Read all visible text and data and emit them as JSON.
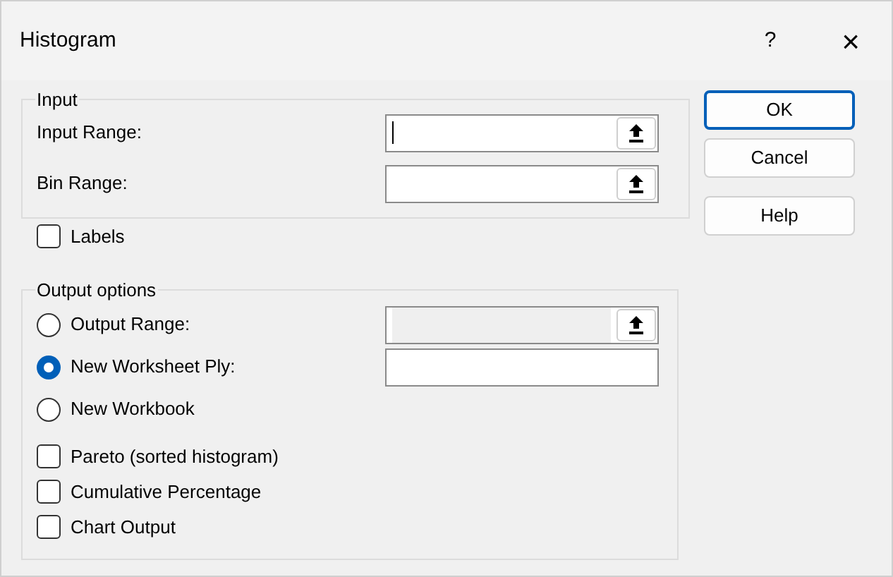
{
  "window": {
    "title": "Histogram",
    "help": "?",
    "close": "×"
  },
  "input_group": {
    "title": "Input",
    "fields": [
      {
        "label": "Input Range:",
        "focused": true
      },
      {
        "label": "Bin Range:",
        "focused": false
      }
    ]
  },
  "labels_option": {
    "label": "Labels",
    "checked": false
  },
  "output_group": {
    "title": "Output options",
    "options": [
      {
        "kind": "radio",
        "label": "Output Range:",
        "selected": false,
        "field": {
          "disabled": true,
          "picker": true
        }
      },
      {
        "kind": "radio",
        "label": "New Worksheet Ply:",
        "selected": true,
        "field": {
          "disabled": false,
          "picker": false
        }
      },
      {
        "kind": "radio",
        "label": "New Workbook",
        "selected": false
      },
      {
        "kind": "checkbox",
        "label": "Pareto (sorted histogram)",
        "checked": false
      },
      {
        "kind": "checkbox",
        "label": "Cumulative Percentage",
        "checked": false
      },
      {
        "kind": "checkbox",
        "label": "Chart Output",
        "checked": false
      }
    ]
  },
  "buttons": [
    {
      "label": "OK",
      "default": true
    },
    {
      "label": "Cancel",
      "default": false
    },
    {
      "label": "Help",
      "default": false
    }
  ]
}
